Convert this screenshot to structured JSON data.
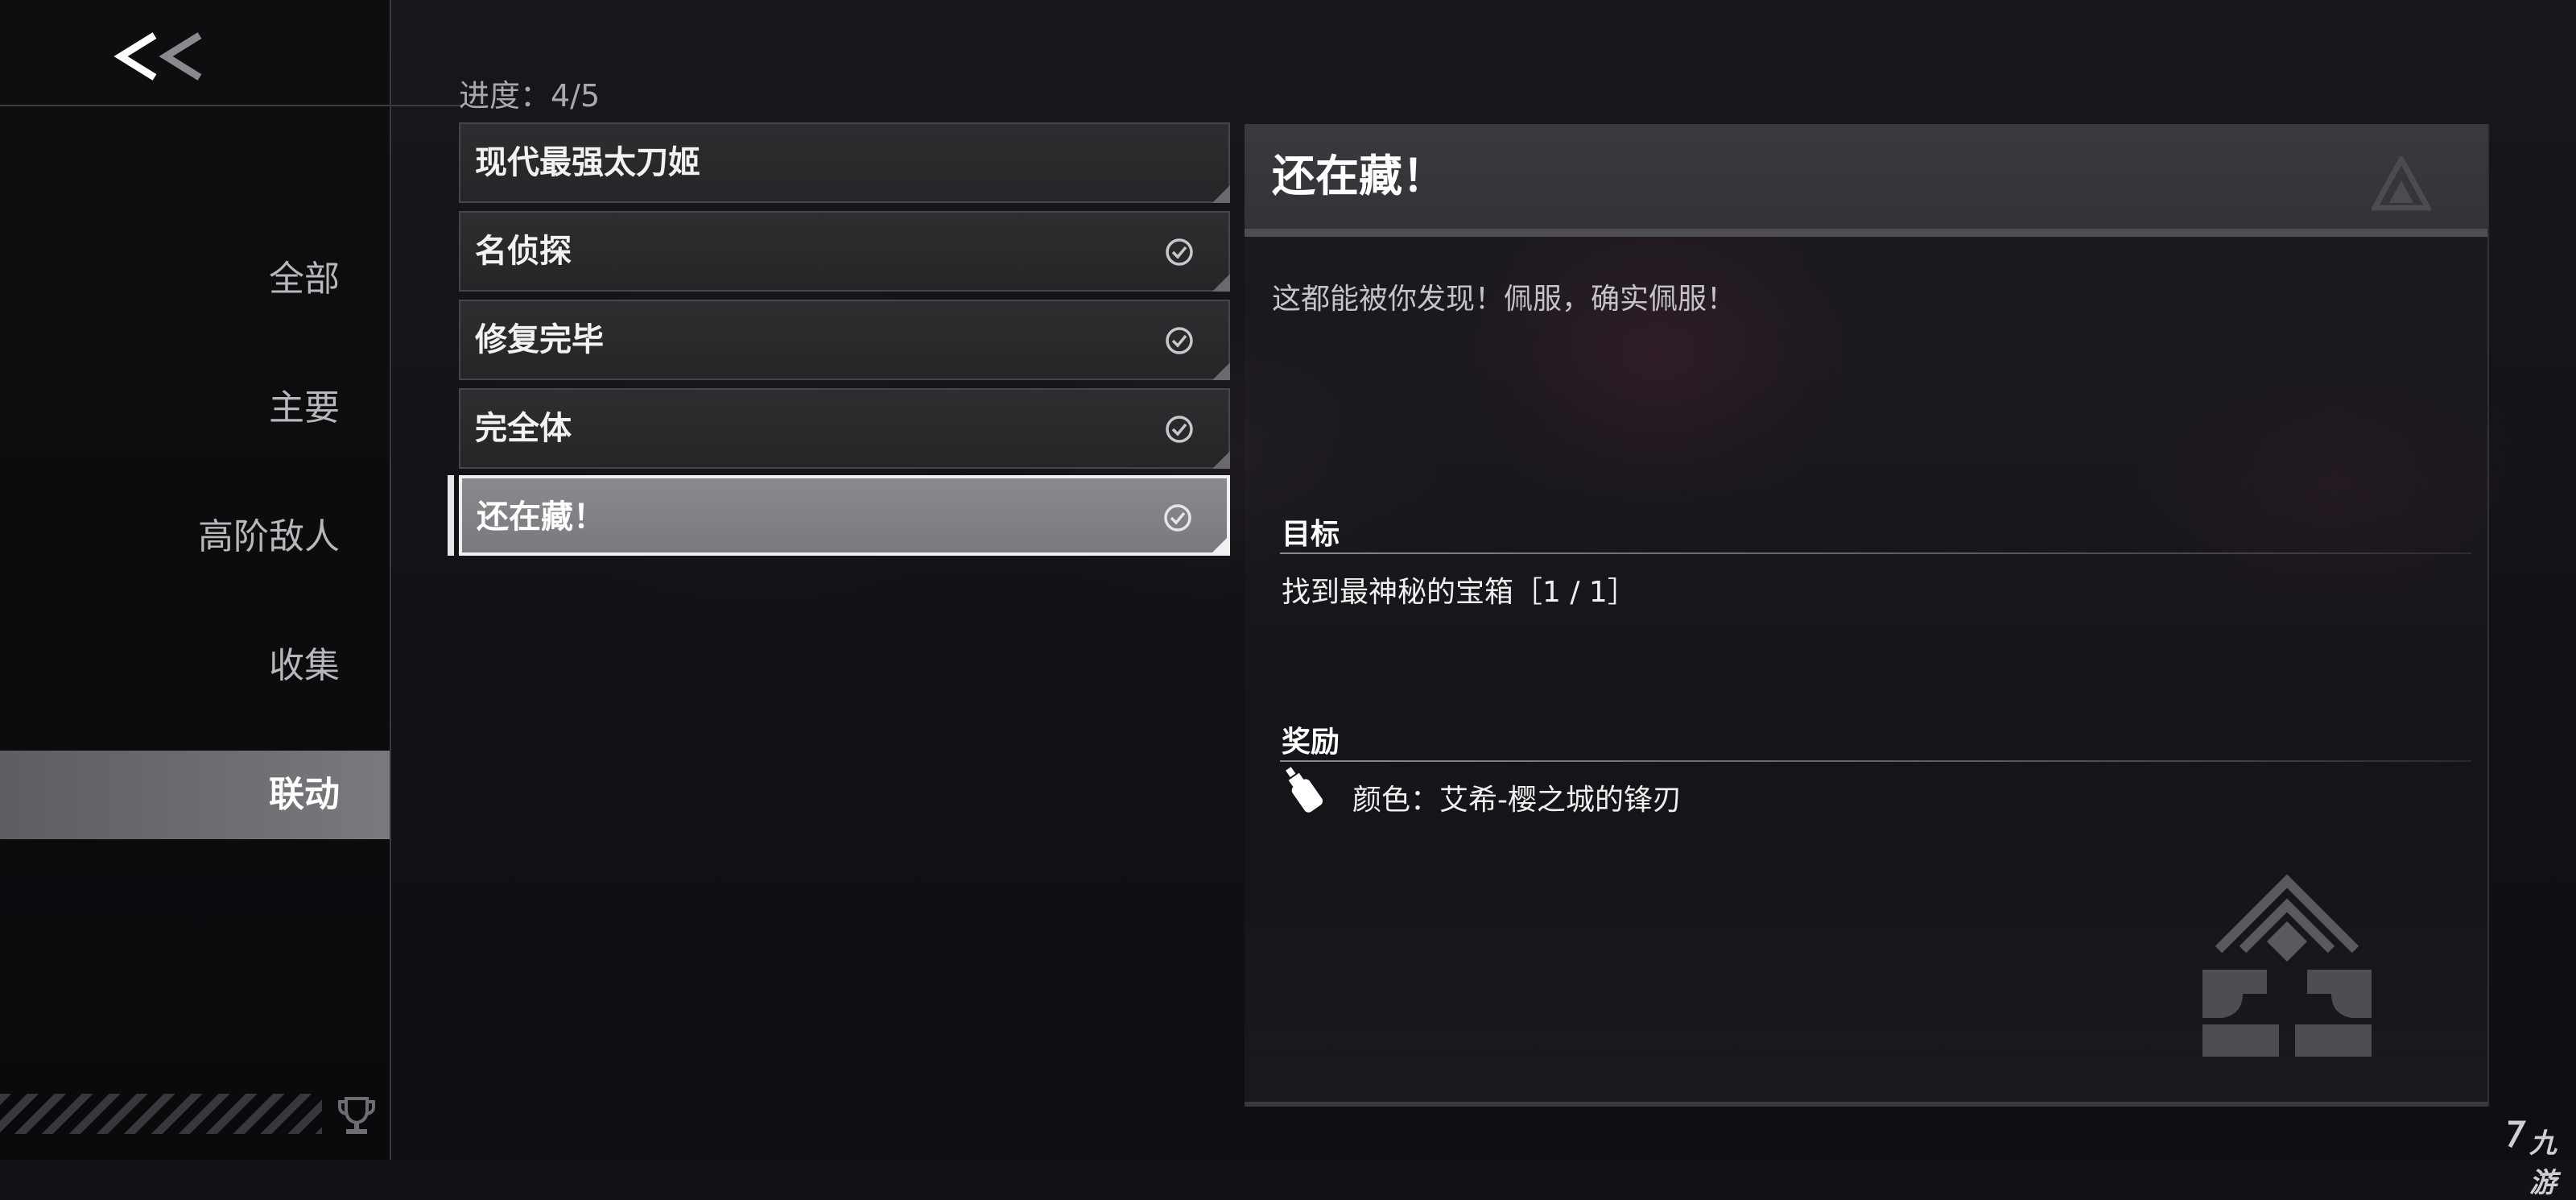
{
  "sidebar": {
    "categories": [
      {
        "label": "全部",
        "active": false
      },
      {
        "label": "主要",
        "active": false
      },
      {
        "label": "高阶敌人",
        "active": false
      },
      {
        "label": "收集",
        "active": false
      },
      {
        "label": "联动",
        "active": true
      }
    ]
  },
  "progress": {
    "text": "进度：4/5",
    "completed": 4,
    "total": 5
  },
  "achievements": [
    {
      "title": "现代最强太刀姬",
      "completed": false,
      "selected": false
    },
    {
      "title": "名侦探",
      "completed": true,
      "selected": false
    },
    {
      "title": "修复完毕",
      "completed": true,
      "selected": false
    },
    {
      "title": "完全体",
      "completed": true,
      "selected": false
    },
    {
      "title": "还在藏！",
      "completed": true,
      "selected": true
    }
  ],
  "detail": {
    "title": "还在藏！",
    "description": "这都能被你发现！佩服，确实佩服！",
    "objective_heading": "目标",
    "objective_text": "找到最神秘的宝箱［1 / 1］",
    "reward_heading": "奖励",
    "reward_text": "颜色：艾希-樱之城的锋刃",
    "reward_icon": "paint-bottle-icon"
  },
  "watermark": {
    "text": "九游"
  },
  "colors": {
    "accent": "#f0f0f0",
    "selected_item": "#808084",
    "active_category": "#6a6a6e"
  }
}
